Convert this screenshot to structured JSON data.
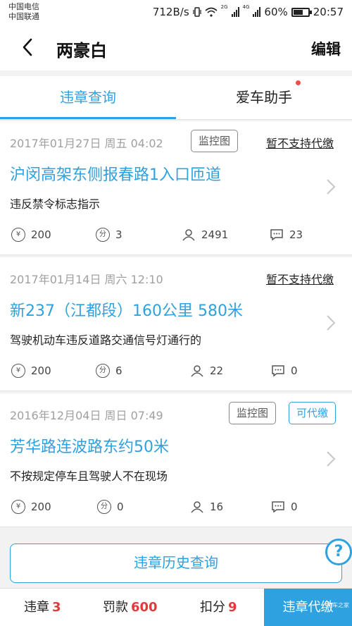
{
  "status_bar": {
    "carrier1": "中国电信",
    "carrier2": "中国联通",
    "speed": "712B/s",
    "battery": "60%",
    "time": "20:57",
    "net1": "2G",
    "net2": "4G"
  },
  "header": {
    "title": "两豪白",
    "edit_label": "编辑"
  },
  "tabs": [
    {
      "label": "违章查询"
    },
    {
      "label": "爱车助手"
    }
  ],
  "violations": [
    {
      "date": "2017年01月27日 周五 04:02",
      "monitor_label": "监控图",
      "status": "暂不支持代缴",
      "location": "沪闵高架东侧报春路1入口匝道",
      "description": "违反禁令标志指示",
      "fine": "200",
      "points": "3",
      "users": "2491",
      "comments": "23"
    },
    {
      "date": "2017年01月14日 周六 12:10",
      "status": "暂不支持代缴",
      "location": "新237（江都段）160公里 580米",
      "description": "驾驶机动车违反道路交通信号灯通行的",
      "fine": "200",
      "points": "6",
      "users": "22",
      "comments": "0"
    },
    {
      "date": "2016年12月04日 周日 07:49",
      "monitor_label": "监控图",
      "pay_label": "可代缴",
      "location": "芳华路连波路东约50米",
      "description": "不按规定停车且驾驶人不在现场",
      "fine": "200",
      "points": "0",
      "users": "16",
      "comments": "0"
    }
  ],
  "icons": {
    "yen": "¥",
    "points": "分",
    "help": "?"
  },
  "history_button": "违章历史查询",
  "bottom_bar": {
    "violations_label": "违章",
    "violations_count": "3",
    "fine_label": "罚款",
    "fine_total": "600",
    "points_label": "扣分",
    "points_total": "9",
    "pay_label": "违章代缴"
  },
  "watermark": "汽车之家",
  "colors": {
    "accent": "#2ea1e0",
    "highlight": "#e23a3a"
  }
}
